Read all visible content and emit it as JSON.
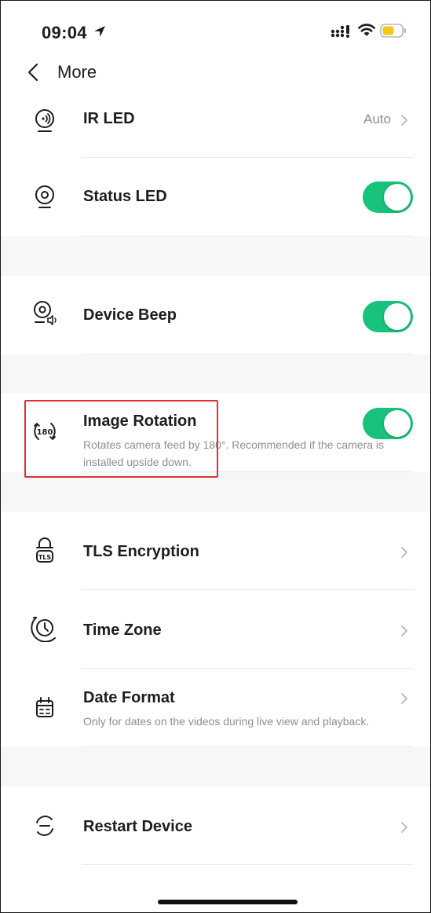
{
  "status_bar": {
    "time": "09:04"
  },
  "nav": {
    "title": "More"
  },
  "rows": {
    "ir_led": {
      "label": "IR LED",
      "value": "Auto"
    },
    "status_led": {
      "label": "Status LED",
      "toggle_on": true
    },
    "device_beep": {
      "label": "Device Beep",
      "toggle_on": true
    },
    "image_rotation": {
      "label": "Image Rotation",
      "description": "Rotates camera feed by 180°. Recommended if the camera is installed upside down.",
      "icon_text": "180",
      "toggle_on": true
    },
    "tls_encryption": {
      "label": "TLS Encryption",
      "icon_text": "TLS"
    },
    "time_zone": {
      "label": "Time Zone"
    },
    "date_format": {
      "label": "Date Format",
      "description": "Only for dates on the videos during live view and playback."
    },
    "restart_device": {
      "label": "Restart Device"
    }
  },
  "colors": {
    "accent_toggle": "#17c27a",
    "highlight_box": "#e0312f",
    "battery": "#f5c518",
    "secondary_text": "#8e8e93",
    "group_background": "#f7f7f8"
  },
  "icons": {
    "ir_led": "ir-led-icon",
    "status_led": "status-led-icon",
    "device_beep": "device-beep-icon",
    "image_rotation": "rotation-180-icon",
    "tls_encryption": "tls-lock-icon",
    "time_zone": "time-zone-icon",
    "date_format": "calendar-icon",
    "restart_device": "restart-icon"
  }
}
